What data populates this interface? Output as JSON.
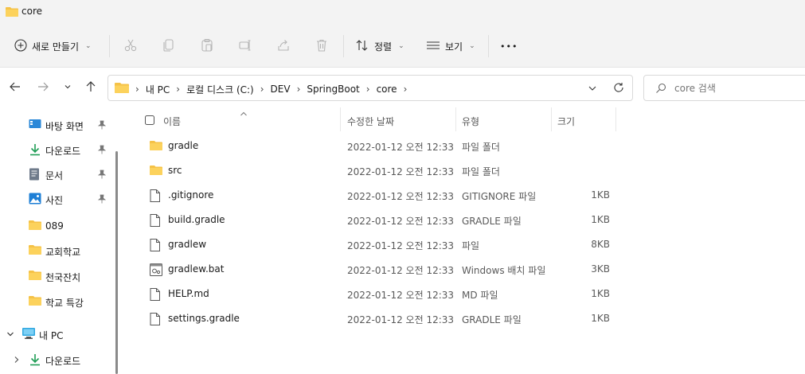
{
  "window": {
    "title": "core"
  },
  "toolbar": {
    "new_label": "새로 만들기",
    "sort_label": "정렬",
    "view_label": "보기",
    "more_label": "•••"
  },
  "address": {
    "crumbs": [
      "내 PC",
      "로컬 디스크 (C:)",
      "DEV",
      "SpringBoot",
      "core"
    ],
    "separator": "›"
  },
  "search": {
    "placeholder": "core 검색"
  },
  "sidebar": {
    "quick": [
      {
        "label": "바탕 화면",
        "icon": "desktop-icon",
        "pinned": true
      },
      {
        "label": "다운로드",
        "icon": "download-icon",
        "pinned": true
      },
      {
        "label": "문서",
        "icon": "document-icon",
        "pinned": true
      },
      {
        "label": "사진",
        "icon": "pictures-icon",
        "pinned": true
      },
      {
        "label": "089",
        "icon": "folder-icon",
        "pinned": false
      },
      {
        "label": "교회학교",
        "icon": "folder-icon",
        "pinned": false
      },
      {
        "label": "천국잔치",
        "icon": "folder-icon",
        "pinned": false
      },
      {
        "label": "학교 특강",
        "icon": "folder-icon",
        "pinned": false
      }
    ],
    "this_pc": {
      "label": "내 PC"
    },
    "this_pc_children": [
      {
        "label": "다운로드"
      }
    ]
  },
  "columns": {
    "name": "이름",
    "date": "수정한 날짜",
    "type": "유형",
    "size": "크기"
  },
  "files": [
    {
      "name": "gradle",
      "date": "2022-01-12 오전 12:33",
      "type": "파일 폴더",
      "size": "",
      "icon": "folder-icon"
    },
    {
      "name": "src",
      "date": "2022-01-12 오전 12:33",
      "type": "파일 폴더",
      "size": "",
      "icon": "folder-icon"
    },
    {
      "name": ".gitignore",
      "date": "2022-01-12 오전 12:33",
      "type": "GITIGNORE 파일",
      "size": "1KB",
      "icon": "file-icon"
    },
    {
      "name": "build.gradle",
      "date": "2022-01-12 오전 12:33",
      "type": "GRADLE 파일",
      "size": "1KB",
      "icon": "file-icon"
    },
    {
      "name": "gradlew",
      "date": "2022-01-12 오전 12:33",
      "type": "파일",
      "size": "8KB",
      "icon": "file-icon"
    },
    {
      "name": "gradlew.bat",
      "date": "2022-01-12 오전 12:33",
      "type": "Windows 배치 파일",
      "size": "3KB",
      "icon": "batch-file-icon"
    },
    {
      "name": "HELP.md",
      "date": "2022-01-12 오전 12:33",
      "type": "MD 파일",
      "size": "1KB",
      "icon": "file-icon"
    },
    {
      "name": "settings.gradle",
      "date": "2022-01-12 오전 12:33",
      "type": "GRADLE 파일",
      "size": "1KB",
      "icon": "file-icon"
    }
  ],
  "colors": {
    "folder": "#f5c247",
    "accent": "#0067c0",
    "chrome": "#f3f3f3"
  }
}
